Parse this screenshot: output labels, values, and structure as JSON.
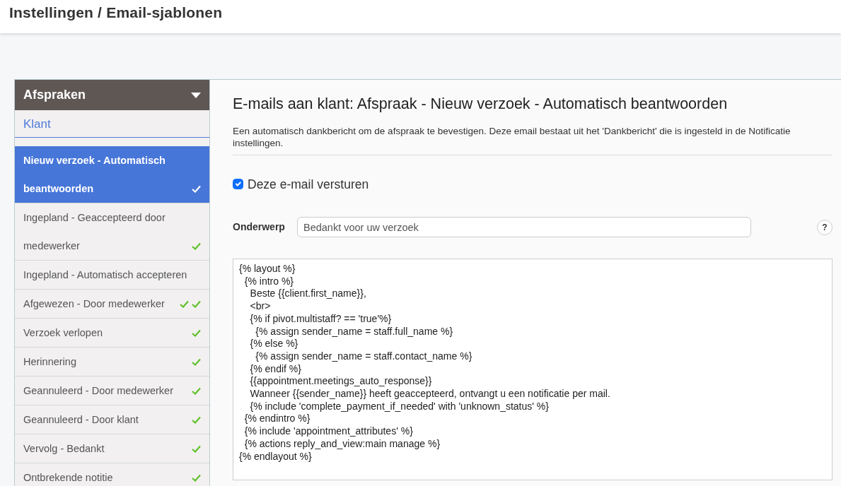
{
  "page_title": "Instellingen / Email-sjablonen",
  "sidebar": {
    "section": "Afspraken",
    "expanded": true,
    "tab": "Klant",
    "items": [
      {
        "label": "Nieuw verzoek - Automatisch beantwoorden",
        "selected": true,
        "checked": true,
        "double": false
      },
      {
        "label": "Ingepland - Geaccepteerd door medewerker",
        "selected": false,
        "checked": true,
        "double": false
      },
      {
        "label": "Ingepland - Automatisch accepteren",
        "selected": false,
        "checked": false,
        "double": false
      },
      {
        "label": "Afgewezen - Door medewerker",
        "selected": false,
        "checked": true,
        "double": true
      },
      {
        "label": "Verzoek verlopen",
        "selected": false,
        "checked": true,
        "double": false
      },
      {
        "label": "Herinnering",
        "selected": false,
        "checked": true,
        "double": false
      },
      {
        "label": "Geannuleerd - Door medewerker",
        "selected": false,
        "checked": true,
        "double": false
      },
      {
        "label": "Geannuleerd - Door klant",
        "selected": false,
        "checked": true,
        "double": false
      },
      {
        "label": "Vervolg - Bedankt",
        "selected": false,
        "checked": true,
        "double": false
      },
      {
        "label": "Ontbrekende notitie",
        "selected": false,
        "checked": true,
        "double": false
      }
    ]
  },
  "editor": {
    "title": "E-mails aan klant: Afspraak - Nieuw verzoek - Automatisch beantwoorden",
    "description": "Een automatisch dankbericht om de afspraak te bevestigen. Deze email bestaat uit het 'Dankbericht' die is ingesteld in de Notificatie instellingen.",
    "send_checkbox": {
      "label": "Deze e-mail versturen",
      "checked": true
    },
    "subject": {
      "label": "Onderwerp",
      "value": "Bedankt voor uw verzoek"
    },
    "help": "?",
    "body": "{% layout %}\n  {% intro %}\n    Beste {{client.first_name}},\n    <br>\n    {% if pivot.multistaff? == 'true'%}\n      {% assign sender_name = staff.full_name %}\n    {% else %}\n      {% assign sender_name = staff.contact_name %}\n    {% endif %}\n    {{appointment.meetings_auto_response}}\n    Wanneer {{sender_name}} heeft geaccepteerd, ontvangt u een notificatie per mail.\n    {% include 'complete_payment_if_needed' with 'unknown_status' %}\n  {% endintro %}\n  {% include 'appointment_attributes' %}\n  {% actions reply_and_view:main manage %}\n{% endlayout %}"
  }
}
